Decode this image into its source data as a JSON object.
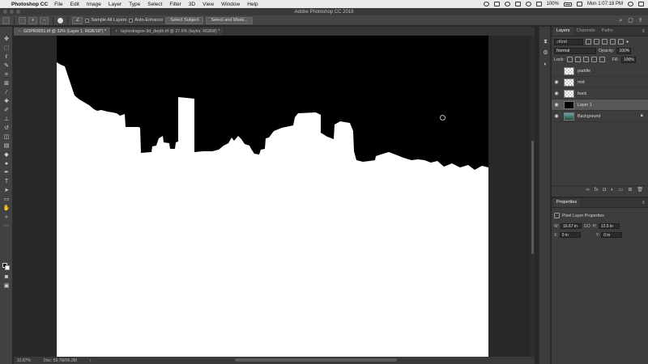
{
  "menubar": {
    "app_name": "Photoshop CC",
    "items": [
      "File",
      "Edit",
      "Image",
      "Layer",
      "Type",
      "Select",
      "Filter",
      "3D",
      "View",
      "Window",
      "Help"
    ],
    "battery": "100%",
    "clock": "Mon 1:07:18 PM"
  },
  "window": {
    "title": "Adobe Photoshop CC 2019"
  },
  "options": {
    "sample_all_layers": "Sample All Layers",
    "auto_enhance": "Auto-Enhance",
    "select_subject": "Select Subject",
    "select_and_mask": "Select and Mask..."
  },
  "tabs": [
    {
      "label": "GOPR0051.tif @ 32% (Layer 1, RGB/16*) *",
      "active": true
    },
    {
      "label": "taylordragon-3d_depth.tif @ 27.6% (taylor, RGB/8) *",
      "active": false
    }
  ],
  "status": {
    "zoom": "31.87%",
    "doc": "Doc: 59.7M/96.3M"
  },
  "layers_panel": {
    "tabs": [
      "Layers",
      "Channels",
      "Paths"
    ],
    "filter_kind": "Kind",
    "blend_mode": "Normal",
    "opacity_label": "Opacity:",
    "opacity": "100%",
    "lock_label": "Lock:",
    "fill_label": "Fill:",
    "fill": "100%",
    "layers": [
      {
        "name": "paddle",
        "visible": false,
        "thumb": "trans",
        "selected": false
      },
      {
        "name": "mid",
        "visible": true,
        "thumb": "trans",
        "selected": false
      },
      {
        "name": "back",
        "visible": true,
        "thumb": "trans",
        "selected": false
      },
      {
        "name": "Layer 1",
        "visible": true,
        "thumb": "black",
        "selected": true
      },
      {
        "name": "Background",
        "visible": true,
        "thumb": "photo",
        "selected": false,
        "locked": true
      }
    ]
  },
  "properties_panel": {
    "title": "Properties",
    "type_label": "Pixel Layer Properties",
    "w_label": "W:",
    "w": "16.67 in",
    "go_label": "GO",
    "h_label": "H:",
    "h": "12.5 in",
    "x_label": "X:",
    "x": "0 in",
    "y_label": "Y:",
    "y": "0 in"
  },
  "colors": {
    "ui_bg": "#282828",
    "panel": "#3d3d3d",
    "canvas_white": "#ffffff",
    "canvas_black": "#000000"
  }
}
